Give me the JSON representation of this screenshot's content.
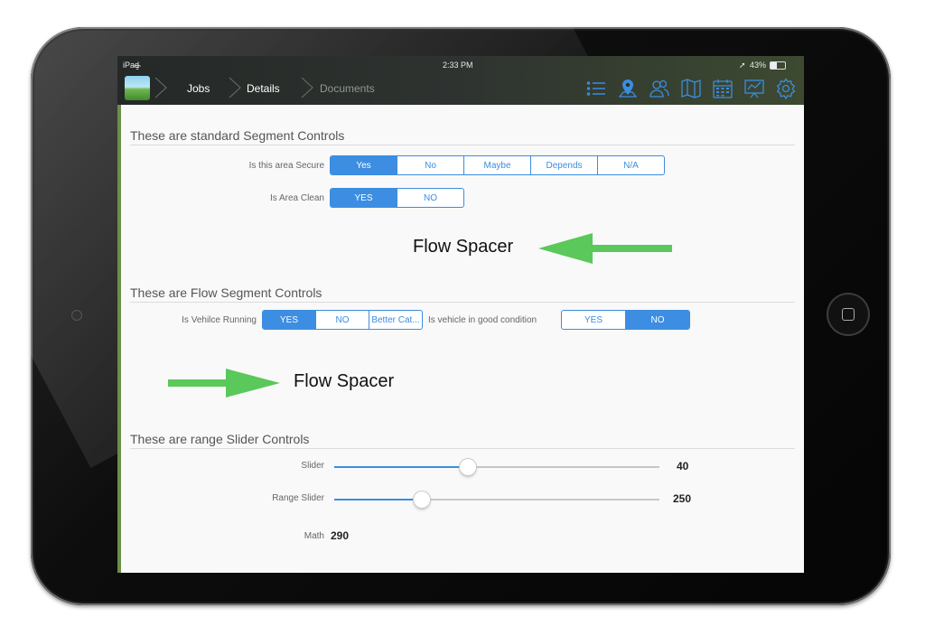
{
  "status_bar": {
    "device": "iPad",
    "time": "2:33 PM",
    "battery": "43%"
  },
  "nav": {
    "breadcrumbs": [
      "Jobs",
      "Details",
      "Documents"
    ],
    "icons": [
      "list-icon",
      "map-pin-icon",
      "contacts-icon",
      "map-icon",
      "calendar-icon",
      "chart-icon",
      "gear-icon"
    ]
  },
  "sections": {
    "standard": {
      "title": "These are standard Segment Controls",
      "secure": {
        "label": "Is this area Secure",
        "options": [
          "Yes",
          "No",
          "Maybe",
          "Depends",
          "N/A"
        ],
        "selected": "Yes"
      },
      "clean": {
        "label": "Is Area Clean",
        "options": [
          "YES",
          "NO"
        ],
        "selected": "YES"
      }
    },
    "flow": {
      "title": "These are Flow Segment Controls",
      "running": {
        "label": "Is Vehilce Running",
        "options": [
          "YES",
          "NO",
          "Better Cat..."
        ],
        "selected": "YES"
      },
      "condition": {
        "label": "Is vehicle in good condition",
        "options": [
          "YES",
          "NO"
        ],
        "selected": "NO"
      }
    },
    "sliders": {
      "title": "These are range Slider Controls",
      "slider": {
        "label": "Slider",
        "value": "40",
        "fraction": 0.41
      },
      "range": {
        "label": "Range Slider",
        "value": "250",
        "fraction": 0.27
      },
      "math": {
        "label": "Math",
        "value": "290"
      }
    }
  },
  "annotations": {
    "spacer1": "Flow Spacer",
    "spacer2": "Flow Spacer"
  },
  "colors": {
    "accent": "#3d8ee2",
    "arrow": "#5ac85a"
  }
}
